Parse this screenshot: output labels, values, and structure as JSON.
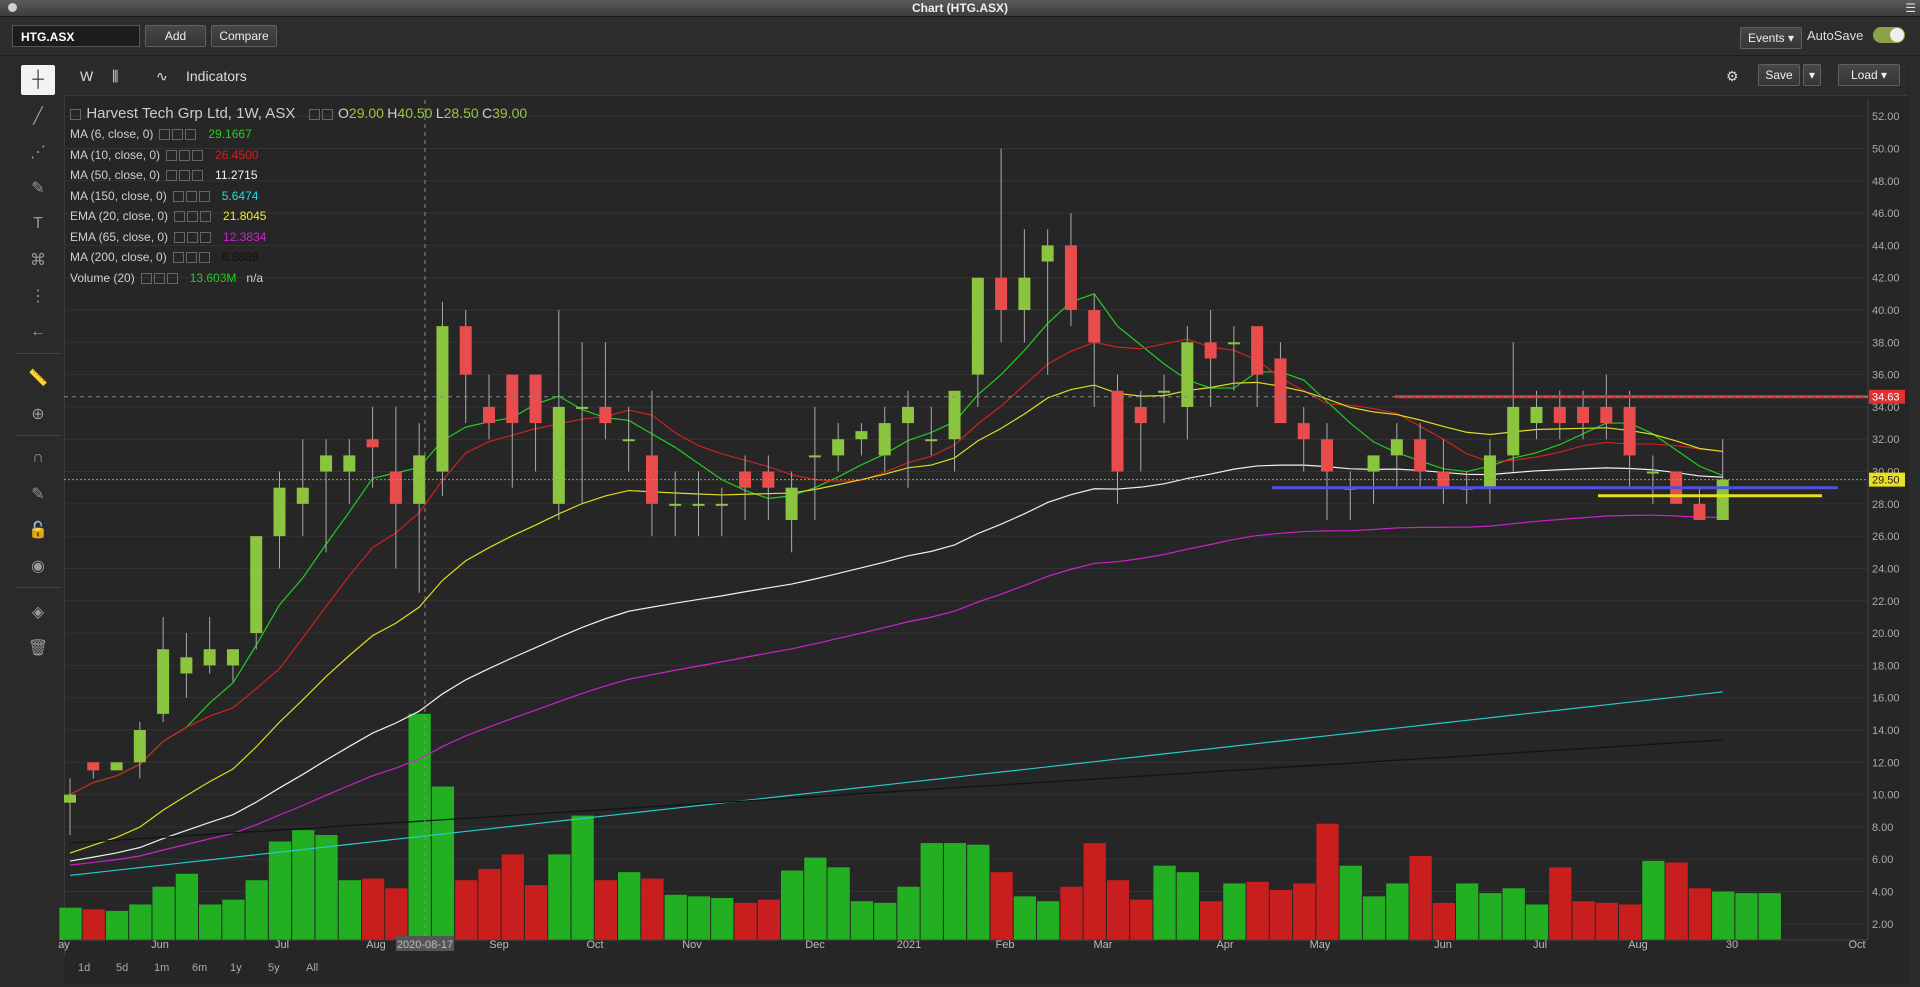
{
  "window": {
    "title": "Chart (HTG.ASX)",
    "menu_icon": "menu-icon"
  },
  "toolbar": {
    "symbol": "HTG.ASX",
    "add": "Add",
    "compare": "Compare",
    "events": "Events",
    "autosave": "AutoSave",
    "autosave_on": true
  },
  "chart_toolbar": {
    "interval": "W",
    "indicators": "Indicators",
    "save": "Save",
    "load": "Load"
  },
  "legend": {
    "name": "Harvest Tech Grp Ltd, 1W, ASX",
    "ohlc": {
      "o_label": "O",
      "o": "29.00",
      "h_label": "H",
      "h": "40.50",
      "l_label": "L",
      "l": "28.50",
      "c_label": "C",
      "c": "39.00"
    },
    "indicators": [
      {
        "label": "MA (6, close, 0)",
        "value": "29.1667",
        "color": "#22cc22"
      },
      {
        "label": "MA (10, close, 0)",
        "value": "26.4500",
        "color": "#cc2222"
      },
      {
        "label": "MA (50, close, 0)",
        "value": "11.2715",
        "color": "#f0f0f0"
      },
      {
        "label": "MA (150, close, 0)",
        "value": "5.6474",
        "color": "#22dddd"
      },
      {
        "label": "EMA (20, close, 0)",
        "value": "21.8045",
        "color": "#eeee22"
      },
      {
        "label": "EMA (65, close, 0)",
        "value": "12.3834",
        "color": "#cc22cc"
      },
      {
        "label": "MA (200, close, 0)",
        "value": "6.6889",
        "color": "#000000"
      },
      {
        "label": "Volume (20)",
        "value": "13.603M",
        "value2": "n/a",
        "color": "#22cc22"
      }
    ]
  },
  "price_axis": {
    "ticks": [
      "52.00",
      "50.00",
      "48.00",
      "46.00",
      "44.00",
      "42.00",
      "40.00",
      "38.00",
      "36.00",
      "34.00",
      "32.00",
      "30.00",
      "28.00",
      "26.00",
      "24.00",
      "22.00",
      "20.00",
      "18.00",
      "16.00",
      "14.00",
      "12.00",
      "10.00",
      "8.00",
      "6.00",
      "4.00",
      "2.00"
    ],
    "marker_red": "34.63",
    "marker_yellow": "29.50"
  },
  "time_axis": {
    "labels": [
      "ay",
      "Jun",
      "Jul",
      "Aug",
      "2020-08-17",
      "Sep",
      "Oct",
      "Nov",
      "Dec",
      "2021",
      "Feb",
      "Mar",
      "Apr",
      "May",
      "Jun",
      "Jul",
      "Aug",
      "30",
      "Oct"
    ]
  },
  "ranges": [
    "1d",
    "5d",
    "1m",
    "6m",
    "1y",
    "5y",
    "All"
  ],
  "chart_data": {
    "type": "candlestick",
    "ohlc": [
      [
        9.5,
        11,
        7.5,
        10
      ],
      [
        12,
        12,
        11,
        11.5
      ],
      [
        11.5,
        12,
        11.5,
        12
      ],
      [
        12,
        14.5,
        11,
        14
      ],
      [
        15,
        21,
        14.5,
        19
      ],
      [
        17.5,
        20,
        16,
        18.5
      ],
      [
        18,
        21,
        17.5,
        19
      ],
      [
        18,
        19,
        17,
        19
      ],
      [
        20,
        26,
        19,
        26
      ],
      [
        26,
        30,
        24,
        29
      ],
      [
        28,
        32,
        26,
        29
      ],
      [
        30,
        32,
        25,
        31
      ],
      [
        30,
        32,
        28,
        31
      ],
      [
        32,
        34,
        29,
        31.5
      ],
      [
        30,
        34,
        24,
        28
      ],
      [
        28,
        33,
        22.5,
        31
      ],
      [
        30,
        40.5,
        28.5,
        39
      ],
      [
        39,
        40,
        33,
        36
      ],
      [
        34,
        36,
        32,
        33
      ],
      [
        36,
        36,
        29,
        33
      ],
      [
        36,
        36,
        30,
        33
      ],
      [
        28,
        40,
        27,
        34
      ],
      [
        34,
        38,
        28,
        34
      ],
      [
        34,
        38,
        32,
        33
      ],
      [
        32,
        34,
        30,
        32
      ],
      [
        31,
        35,
        26,
        28
      ],
      [
        28,
        30,
        26,
        28
      ],
      [
        28,
        30,
        26,
        28
      ],
      [
        28,
        29,
        26,
        28
      ],
      [
        30,
        31,
        27,
        29
      ],
      [
        30,
        31,
        27,
        29
      ],
      [
        27,
        30,
        25,
        29
      ],
      [
        31,
        34,
        27,
        31
      ],
      [
        31,
        33,
        30,
        32
      ],
      [
        32,
        33,
        31,
        32.5
      ],
      [
        31,
        34,
        30,
        33
      ],
      [
        33,
        35,
        29,
        34
      ],
      [
        32,
        34,
        31,
        32
      ],
      [
        32,
        35,
        30,
        35
      ],
      [
        36,
        40,
        34,
        42
      ],
      [
        42,
        50,
        38,
        40
      ],
      [
        40,
        45,
        38,
        42
      ],
      [
        43,
        45,
        36,
        44
      ],
      [
        44,
        46,
        39,
        40
      ],
      [
        40,
        41,
        34,
        38
      ],
      [
        35,
        36,
        28,
        30
      ],
      [
        34,
        35,
        30,
        33
      ],
      [
        35,
        36,
        33,
        35
      ],
      [
        34,
        39,
        32,
        38
      ],
      [
        38,
        40,
        34,
        37
      ],
      [
        38,
        39,
        35,
        38
      ],
      [
        39,
        39,
        34,
        36
      ],
      [
        37,
        38,
        33,
        33
      ],
      [
        33,
        34,
        30,
        32
      ],
      [
        32,
        33,
        27,
        30
      ],
      [
        29,
        30,
        27,
        29
      ],
      [
        30,
        31,
        28,
        31
      ],
      [
        31,
        33,
        29,
        32
      ],
      [
        32,
        33,
        29,
        30
      ],
      [
        30,
        32,
        28,
        29
      ],
      [
        29,
        30,
        28,
        29
      ],
      [
        29,
        32,
        28,
        31
      ],
      [
        31,
        38,
        30,
        34
      ],
      [
        33,
        35,
        32,
        34
      ],
      [
        34,
        35,
        32,
        33
      ],
      [
        34,
        35,
        32,
        33
      ],
      [
        34,
        36,
        32,
        33
      ],
      [
        34,
        35,
        29,
        31
      ],
      [
        30,
        31,
        28,
        30
      ],
      [
        30,
        30,
        28,
        28
      ],
      [
        28,
        29,
        27,
        27
      ],
      [
        27,
        32,
        27,
        29.5
      ]
    ],
    "volume_mln": [
      2,
      1.9,
      1.8,
      2.2,
      3.3,
      4.1,
      2.2,
      2.5,
      3.7,
      6.1,
      6.8,
      6.5,
      3.7,
      3.8,
      3.2,
      14,
      9.5,
      3.7,
      4.4,
      5.3,
      3.4,
      5.3,
      7.7,
      3.7,
      4.2,
      3.8,
      2.8,
      2.7,
      2.6,
      2.3,
      2.5,
      4.3,
      5.1,
      4.5,
      2.4,
      2.3,
      3.3,
      6,
      6,
      5.9,
      4.2,
      2.7,
      2.4,
      3.3,
      6,
      3.7,
      2.5,
      4.6,
      4.2,
      2.4,
      3.5,
      3.6,
      3.1,
      3.5,
      7.2,
      4.6,
      2.7,
      3.5,
      5.2,
      2.3,
      3.5,
      2.9,
      3.2,
      2.2,
      4.5,
      2.4,
      2.3,
      2.2,
      4.9,
      4.8,
      3.2,
      3,
      2.9,
      2.9
    ],
    "horizontal_lines": [
      {
        "value": 34.63,
        "color": "#e03030"
      },
      {
        "value": 29.0,
        "color": "#5050e0"
      },
      {
        "value": 28.5,
        "color": "#e0e020"
      }
    ],
    "ylim": [
      1,
      53
    ]
  }
}
